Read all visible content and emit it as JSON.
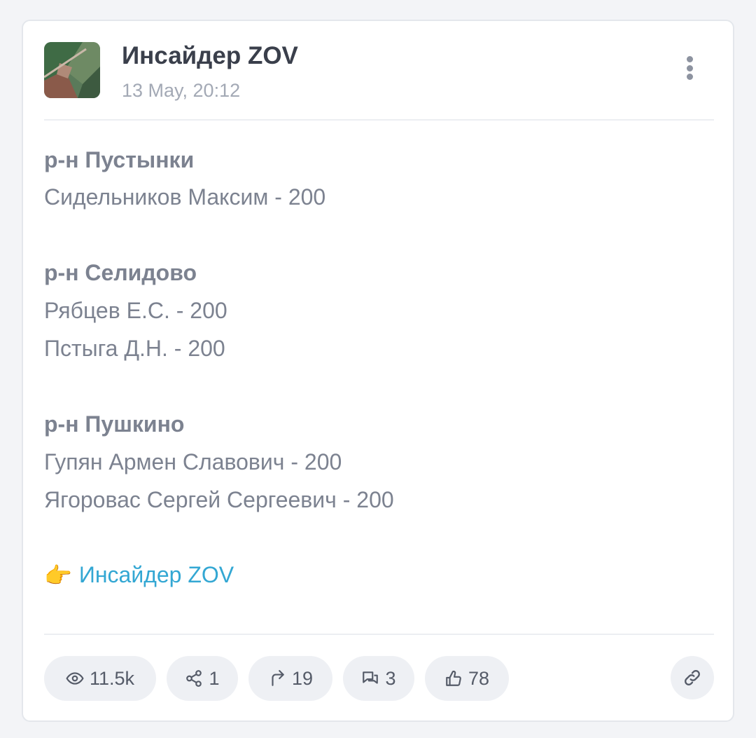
{
  "post": {
    "channel_name": "Инсайдер ZOV",
    "date": "13 May, 20:12",
    "lines": [
      {
        "text": "р-н Пустынки",
        "kind": "region"
      },
      {
        "text": "Сидельников Максим - 200",
        "kind": "entry"
      },
      {
        "text": "р-н Селидово",
        "kind": "region"
      },
      {
        "text": "Рябцев Е.С. - 200",
        "kind": "entry"
      },
      {
        "text": "Пстыга Д.Н. - 200",
        "kind": "entry"
      },
      {
        "text": "р-н Пушкино",
        "kind": "region"
      },
      {
        "text": "Гупян Армен Славович - 200",
        "kind": "entry"
      },
      {
        "text": "Ягоровас Сергей Сергеевич - 200",
        "kind": "entry"
      }
    ],
    "signature": {
      "emoji": "👉",
      "link_text": "Инсайдер ZOV"
    }
  },
  "stats": {
    "views": "11.5k",
    "shares": "1",
    "forwards": "19",
    "comments": "3",
    "likes": "78"
  },
  "icons": {
    "menu": "more-vertical-icon",
    "views": "eye-icon",
    "shares": "share-nodes-icon",
    "forwards": "forward-arrow-icon",
    "comments": "comments-icon",
    "likes": "thumbs-up-icon",
    "link": "link-icon"
  },
  "colors": {
    "link": "#33a7d3",
    "text": "#7c8290",
    "title": "#3a3f4b",
    "muted": "#a3a9b5",
    "pill_bg": "#eef0f4"
  }
}
